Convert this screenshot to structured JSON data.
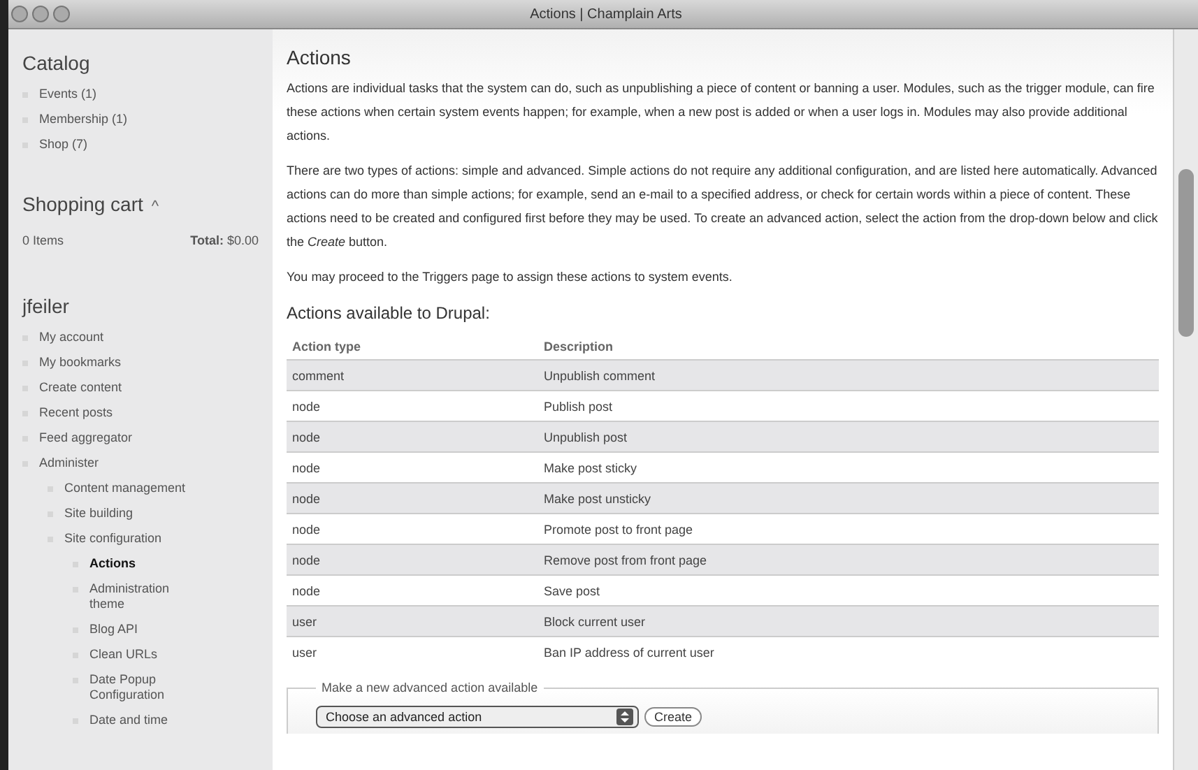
{
  "window": {
    "title": "Actions | Champlain Arts"
  },
  "sidebar": {
    "catalog": {
      "title": "Catalog",
      "items": [
        "Events (1)",
        "Membership (1)",
        "Shop (7)"
      ]
    },
    "cart": {
      "title": "Shopping cart",
      "toggle": "^",
      "items": "0 Items",
      "total": "**Total:** $0.00"
    },
    "user": {
      "title": "jfeiler",
      "items": [
        {
          "label": "My account",
          "selected": false
        },
        {
          "label": "My bookmarks",
          "selected": false
        },
        {
          "label": "Create content",
          "selected": false
        },
        {
          "label": "Recent posts",
          "selected": false
        },
        {
          "label": "Feed aggregator",
          "selected": false
        },
        {
          "label": "Administer",
          "selected": false,
          "children": [
            {
              "label": "Content management",
              "selected": false
            },
            {
              "label": "Site building",
              "selected": false
            },
            {
              "label": "Site configuration",
              "selected": false,
              "children": [
                {
                  "label": "Actions",
                  "selected": true
                },
                {
                  "label": "Administration theme",
                  "selected": false
                },
                {
                  "label": "Blog API",
                  "selected": false
                },
                {
                  "label": "Clean URLs",
                  "selected": false
                },
                {
                  "label": "Date Popup Configuration",
                  "selected": false
                },
                {
                  "label": "Date and time",
                  "selected": false
                }
              ]
            }
          ]
        }
      ]
    }
  },
  "main": {
    "title": "Actions",
    "paragraphs": [
      "Actions are individual tasks that the system can do, such as unpublishing a piece of content or banning a user. Modules, such as the trigger module, can fire these actions when certain system events happen; for example, when a new post is added or when a user logs in. Modules may also provide additional actions.",
      "There are two types of actions: simple and advanced. Simple actions do not require any additional configuration, and are listed here automatically. Advanced actions can do more than simple actions; for example, send an e-mail to a specified address, or check for certain words within a piece of content. These actions need to be created and configured first before they may be used. To create an advanced action, select the action from the drop-down below and click the *Create* button.",
      "You may proceed to the Triggers page to assign these actions to system events."
    ],
    "subtitle": "Actions available to Drupal:",
    "table": {
      "columns": [
        "Action type",
        "Description"
      ],
      "rows": [
        [
          "comment",
          "Unpublish comment"
        ],
        [
          "node",
          "Publish post"
        ],
        [
          "node",
          "Unpublish post"
        ],
        [
          "node",
          "Make post sticky"
        ],
        [
          "node",
          "Make post unsticky"
        ],
        [
          "node",
          "Promote post to front page"
        ],
        [
          "node",
          "Remove post from front page"
        ],
        [
          "node",
          "Save post"
        ],
        [
          "user",
          "Block current user"
        ],
        [
          "user",
          "Ban IP address of current user"
        ]
      ]
    },
    "fieldset": {
      "legend": "Make a new advanced action available",
      "select": "Choose an advanced action",
      "button": "Create"
    }
  }
}
